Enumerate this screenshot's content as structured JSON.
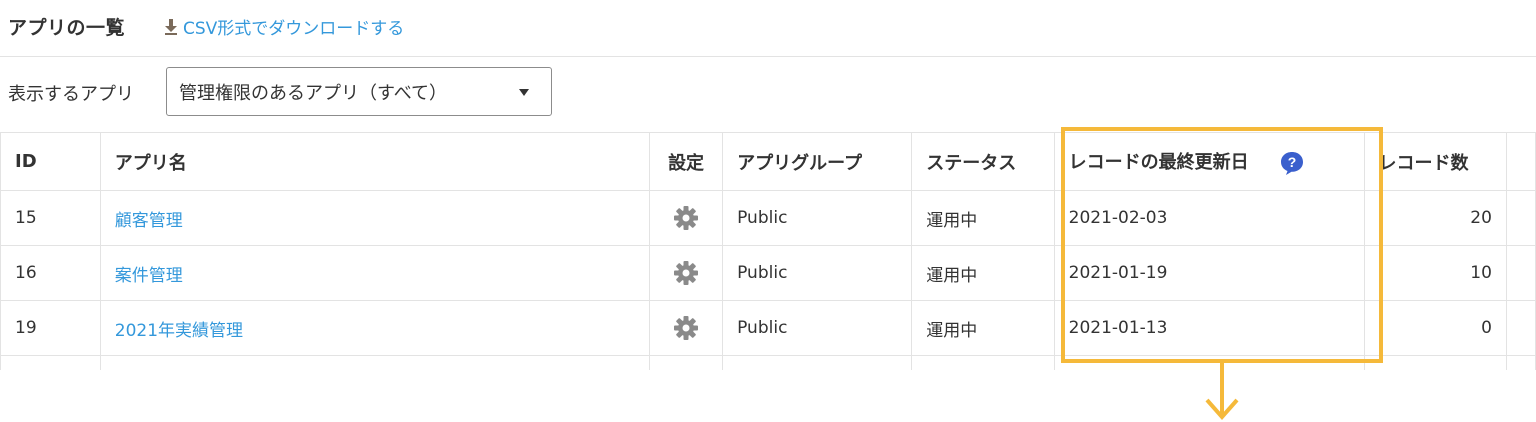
{
  "header": {
    "title": "アプリの一覧",
    "csv_link": "CSV形式でダウンロードする"
  },
  "filter": {
    "label": "表示するアプリ",
    "selected": "管理権限のあるアプリ（すべて）"
  },
  "table": {
    "columns": {
      "id": "ID",
      "name": "アプリ名",
      "settings": "設定",
      "group": "アプリグループ",
      "status": "ステータス",
      "updated": "レコードの最終更新日",
      "records": "レコード数"
    },
    "rows": [
      {
        "id": "15",
        "name": "顧客管理",
        "group": "Public",
        "status": "運用中",
        "updated": "2021-02-03",
        "records": "20"
      },
      {
        "id": "16",
        "name": "案件管理",
        "group": "Public",
        "status": "運用中",
        "updated": "2021-01-19",
        "records": "10"
      },
      {
        "id": "19",
        "name": "2021年実績管理",
        "group": "Public",
        "status": "運用中",
        "updated": "2021-01-13",
        "records": "0"
      }
    ]
  },
  "colors": {
    "link": "#3498db",
    "highlight": "#f5b93a",
    "help_icon": "#3a5fcd",
    "gear": "#8a8a8a"
  },
  "icons": {
    "download": "download-icon",
    "caret": "caret-down-icon",
    "help": "help-icon",
    "settings": "gear-icon",
    "annotation_arrow": "arrow-down-icon"
  }
}
